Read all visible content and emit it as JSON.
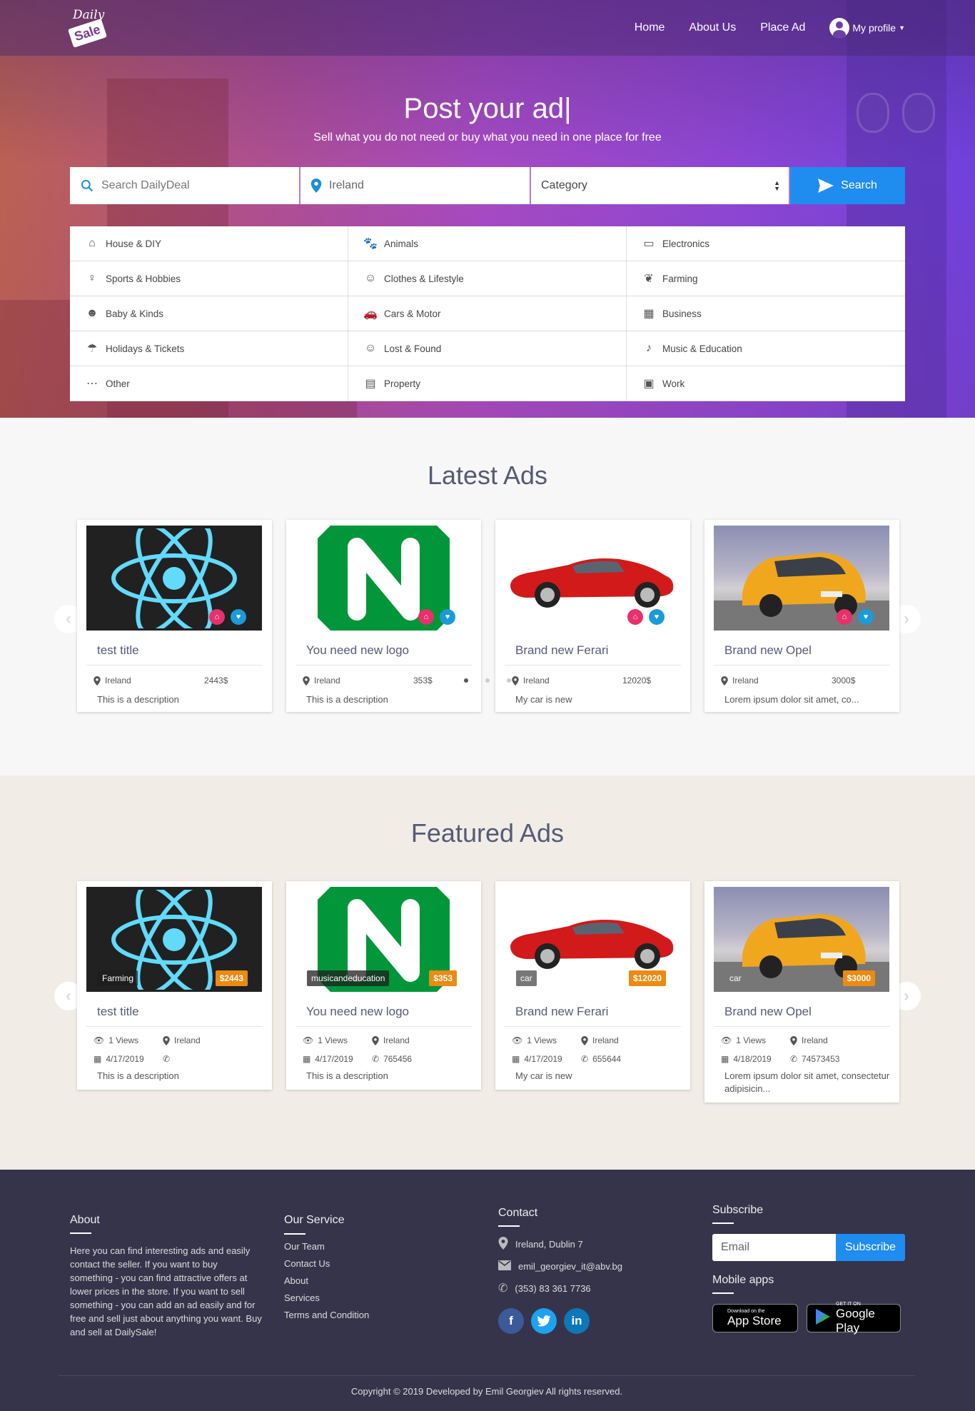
{
  "nav": {
    "logo_line1": "Daily",
    "logo_line2": "Sale",
    "links": [
      "Home",
      "About Us",
      "Place Ad"
    ],
    "profile": "My profile"
  },
  "hero": {
    "title": "Post your ad|",
    "subtitle": "Sell what you do not need or buy what you need in one place for free",
    "search_placeholder": "Search DailyDeal",
    "location": "Ireland",
    "category": "Category",
    "search_button": "Search"
  },
  "categories": [
    {
      "label": "House & DIY",
      "icon": "house-icon"
    },
    {
      "label": "Animals",
      "icon": "paw-icon"
    },
    {
      "label": "Electronics",
      "icon": "devices-icon"
    },
    {
      "label": "Sports & Hobbies",
      "icon": "person-icon"
    },
    {
      "label": "Clothes & Lifestyle",
      "icon": "face-icon"
    },
    {
      "label": "Farming",
      "icon": "plant-icon"
    },
    {
      "label": "Baby & Kinds",
      "icon": "baby-icon"
    },
    {
      "label": "Cars & Motor",
      "icon": "car-icon"
    },
    {
      "label": "Business",
      "icon": "building-icon"
    },
    {
      "label": "Holidays & Tickets",
      "icon": "beach-icon"
    },
    {
      "label": "Lost & Found",
      "icon": "smile-icon"
    },
    {
      "label": "Music & Education",
      "icon": "music-icon"
    },
    {
      "label": "Other",
      "icon": "more-icon"
    },
    {
      "label": "Property",
      "icon": "store-icon"
    },
    {
      "label": "Work",
      "icon": "briefcase-icon"
    }
  ],
  "latest": {
    "title": "Latest Ads",
    "ads": [
      {
        "title": "test title",
        "location": "Ireland",
        "price": "2443$",
        "desc": "This is a description",
        "image": "react"
      },
      {
        "title": "You need new logo",
        "location": "Ireland",
        "price": "353$",
        "desc": "This is a description",
        "image": "ng"
      },
      {
        "title": "Brand new Ferari",
        "location": "Ireland",
        "price": "12020$",
        "desc": "My car is new",
        "image": "fer"
      },
      {
        "title": "Brand new Opel",
        "location": "Ireland",
        "price": "3000$",
        "desc": "Lorem ipsum dolor sit amet, co...",
        "image": "opel"
      }
    ]
  },
  "featured": {
    "title": "Featured Ads",
    "ads": [
      {
        "title": "test title",
        "category": "Farming",
        "price": "$2443",
        "views": "1 Views",
        "location": "Ireland",
        "date": "4/17/2019",
        "phone": "",
        "desc": "This is a description",
        "image": "react"
      },
      {
        "title": "You need new logo",
        "category": "musicandeducation",
        "price": "$353",
        "views": "1 Views",
        "location": "Ireland",
        "date": "4/17/2019",
        "phone": "765456",
        "desc": "This is a description",
        "image": "ng"
      },
      {
        "title": "Brand new Ferari",
        "category": "car",
        "price": "$12020",
        "views": "1 Views",
        "location": "Ireland",
        "date": "4/17/2019",
        "phone": "655644",
        "desc": "My car is new",
        "image": "fer"
      },
      {
        "title": "Brand new Opel",
        "category": "car",
        "price": "$3000",
        "views": "1 Views",
        "location": "Ireland",
        "date": "4/18/2019",
        "phone": "74573453",
        "desc": "Lorem ipsum dolor sit amet, consectetur adipisicin...",
        "image": "opel"
      }
    ]
  },
  "footer": {
    "about_title": "About",
    "about_text": "Here you can find interesting ads and easily contact the seller. If you want to buy something - you can find attractive offers at lower prices in the store. If you want to sell something - you can add an ad easily and for free and sell just about anything you want. Buy and sell at DailySale!",
    "service_title": "Our Service",
    "service_links": [
      "Our Team",
      "Contact Us",
      "About",
      "Services",
      "Terms and Condition"
    ],
    "contact_title": "Contact",
    "address": "Ireland, Dublin 7",
    "email": "emil_georgiev_it@abv.bg",
    "phone": "(353) 83 361 7736",
    "subscribe_title": "Subscribe",
    "email_placeholder": "Email",
    "subscribe_button": "Subscribe",
    "mobile_title": "Mobile apps",
    "appstore_small": "Download on the",
    "appstore": "App Store",
    "google_small": "GET IT ON",
    "google": "Google Play",
    "copyright": "Copyright © 2019 Developed by Emil Georgiev All rights reserved."
  },
  "colors": {
    "accent": "#1f8cf0",
    "badge_pink": "#e8306b",
    "badge_blue": "#1a9bd8",
    "price_tag": "#ec8a12",
    "footer": "#36344b"
  }
}
